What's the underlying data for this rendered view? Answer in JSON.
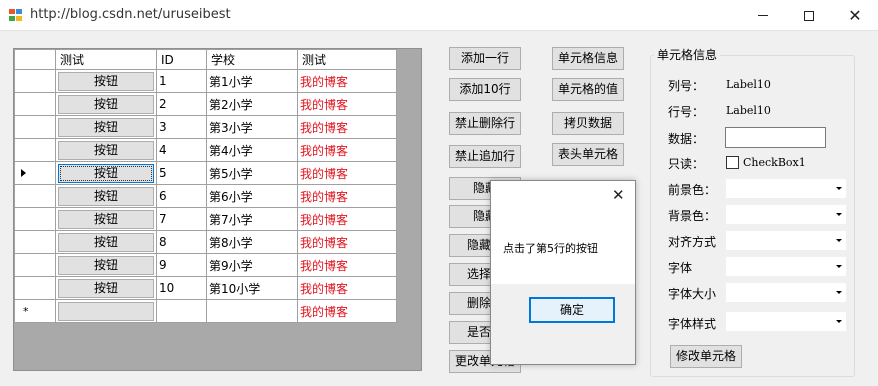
{
  "window": {
    "title": "http://blog.csdn.net/uruseibest",
    "close_glyph": "✕"
  },
  "grid": {
    "headers": [
      "测试",
      "ID",
      "学校",
      "测试"
    ],
    "rows": [
      {
        "button": "按钮",
        "id": "1",
        "school": "第1小学",
        "test": "我的博客"
      },
      {
        "button": "按钮",
        "id": "2",
        "school": "第2小学",
        "test": "我的博客"
      },
      {
        "button": "按钮",
        "id": "3",
        "school": "第3小学",
        "test": "我的博客"
      },
      {
        "button": "按钮",
        "id": "4",
        "school": "第4小学",
        "test": "我的博客"
      },
      {
        "button": "按钮",
        "id": "5",
        "school": "第5小学",
        "test": "我的博客"
      },
      {
        "button": "按钮",
        "id": "6",
        "school": "第6小学",
        "test": "我的博客"
      },
      {
        "button": "按钮",
        "id": "7",
        "school": "第7小学",
        "test": "我的博客"
      },
      {
        "button": "按钮",
        "id": "8",
        "school": "第8小学",
        "test": "我的博客"
      },
      {
        "button": "按钮",
        "id": "9",
        "school": "第9小学",
        "test": "我的博客"
      },
      {
        "button": "按钮",
        "id": "10",
        "school": "第10小学",
        "test": "我的博客"
      }
    ],
    "new_row": {
      "marker": "*",
      "test": "我的博客"
    }
  },
  "buttons_col1": [
    "添加一行",
    "添加10行",
    "禁止删除行",
    "禁止追加行",
    "隐藏",
    "隐藏",
    "隐藏表",
    "选择多",
    "删除多",
    "是否新",
    "更改单元格"
  ],
  "buttons_col2": [
    "单元格信息",
    "单元格的值",
    "拷贝数据",
    "表头单元格"
  ],
  "cell_info": {
    "title": "单元格信息",
    "col_label": "列号：",
    "col_value": "Label10",
    "row_label": "行号：",
    "row_value": "Label10",
    "data_label": "数据：",
    "readonly_label": "只读：",
    "checkbox_label": "CheckBox1",
    "fore_label": "前景色：",
    "back_label": "背景色：",
    "align_label": "对齐方式",
    "font_label": "字体",
    "fontsize_label": "字体大小",
    "fontstyle_label": "字体样式",
    "modify_button": "修改单元格"
  },
  "dialog": {
    "message": "点击了第5行的按钮",
    "ok": "确定",
    "close_glyph": "✕"
  },
  "colors": {
    "link_red": "#e0141e",
    "focus_blue": "#0078d7"
  }
}
